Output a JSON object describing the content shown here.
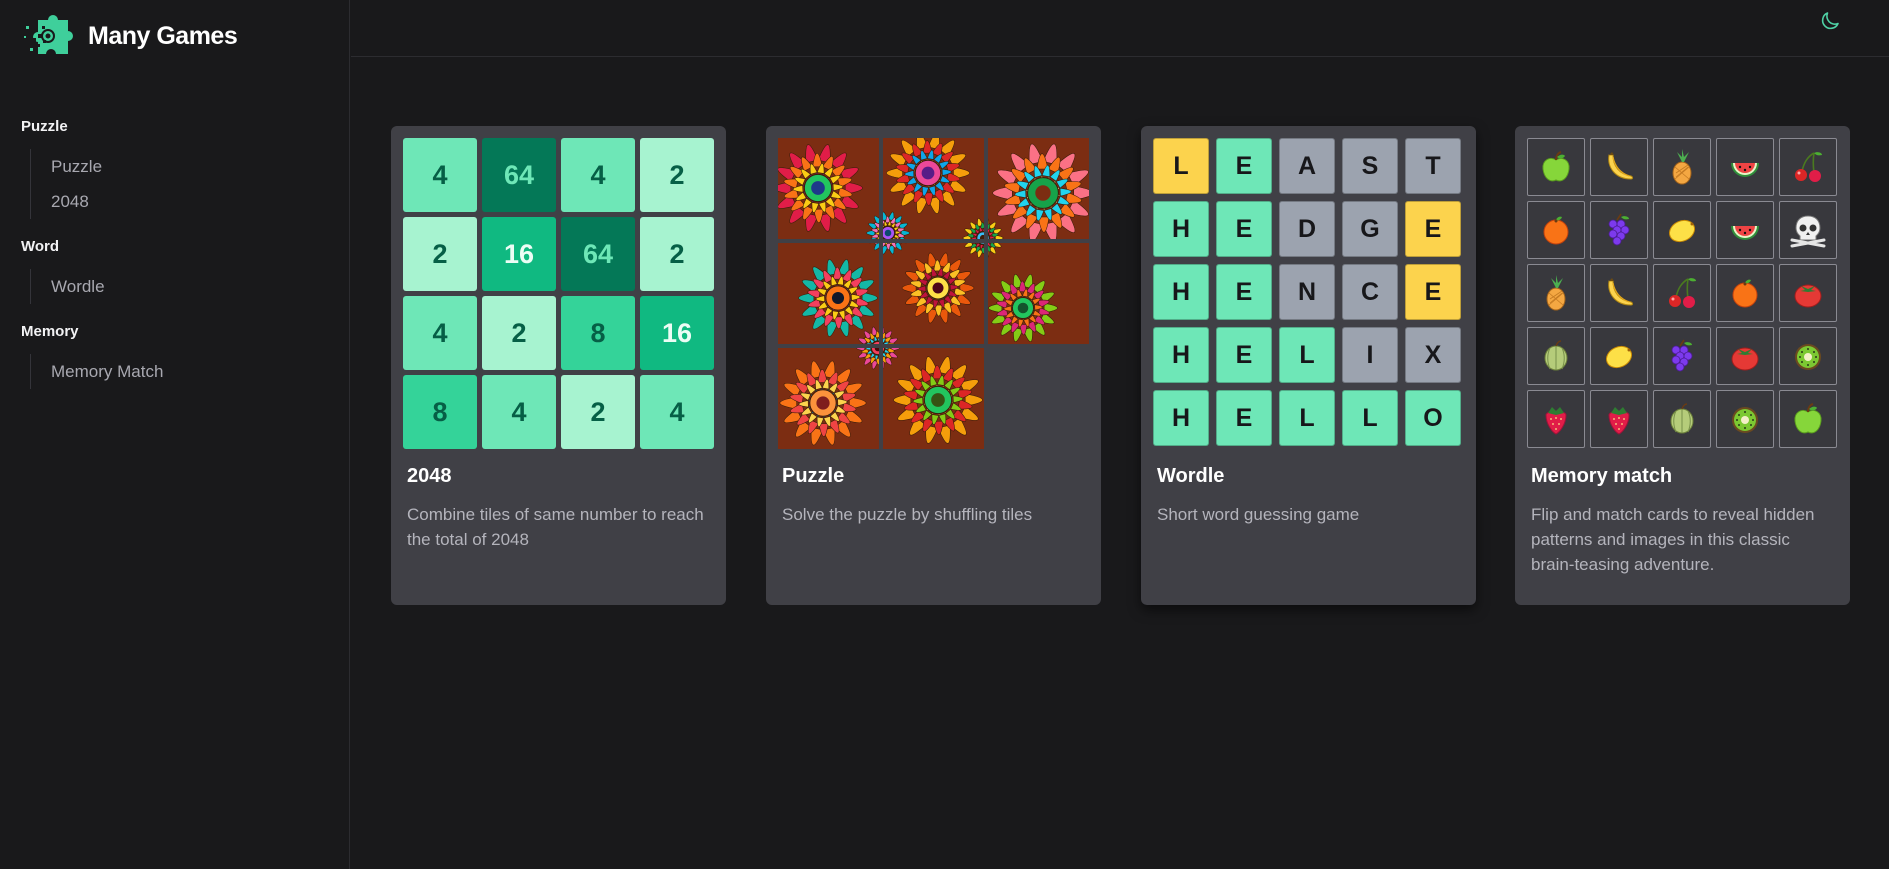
{
  "app": {
    "name": "Many Games"
  },
  "sidebar": {
    "groups": [
      {
        "title": "Puzzle",
        "items": [
          "Puzzle",
          "2048"
        ]
      },
      {
        "title": "Word",
        "items": [
          "Wordle"
        ]
      },
      {
        "title": "Memory",
        "items": [
          "Memory Match"
        ]
      }
    ]
  },
  "header": {
    "theme_toggle_icon": "moon-icon"
  },
  "colors": {
    "accent": "#4fd1a5",
    "card_bg": "#404046",
    "page_bg": "#19191b",
    "wordle_correct": "#6ee7b7",
    "wordle_present": "#fcd34d",
    "wordle_absent": "#9ca3af"
  },
  "cards": [
    {
      "title": "2048",
      "description": "Combine tiles of same number to reach the total of 2048",
      "tiles": [
        4,
        64,
        4,
        2,
        2,
        16,
        64,
        2,
        4,
        2,
        8,
        16,
        8,
        4,
        2,
        4
      ]
    },
    {
      "title": "Puzzle",
      "description": "Solve the puzzle by shuffling tiles",
      "tile_count": 8
    },
    {
      "title": "Wordle",
      "description": "Short word guessing game",
      "rows": [
        {
          "letters": [
            "L",
            "E",
            "A",
            "S",
            "T"
          ],
          "states": [
            "present",
            "correct",
            "absent",
            "absent",
            "absent"
          ]
        },
        {
          "letters": [
            "H",
            "E",
            "D",
            "G",
            "E"
          ],
          "states": [
            "correct",
            "correct",
            "absent",
            "absent",
            "present"
          ]
        },
        {
          "letters": [
            "H",
            "E",
            "N",
            "C",
            "E"
          ],
          "states": [
            "correct",
            "correct",
            "absent",
            "absent",
            "present"
          ]
        },
        {
          "letters": [
            "H",
            "E",
            "L",
            "I",
            "X"
          ],
          "states": [
            "correct",
            "correct",
            "correct",
            "absent",
            "absent"
          ]
        },
        {
          "letters": [
            "H",
            "E",
            "L",
            "L",
            "O"
          ],
          "states": [
            "correct",
            "correct",
            "correct",
            "correct",
            "correct"
          ]
        }
      ]
    },
    {
      "title": "Memory match",
      "description": "Flip and match cards to reveal hidden patterns and images in this classic brain-teasing adventure.",
      "cards": [
        "apple",
        "banana",
        "pineapple",
        "watermelon",
        "cherry",
        "orange",
        "grapes",
        "lemon",
        "watermelon",
        "skull",
        "pineapple",
        "banana",
        "cherry",
        "orange",
        "tomato",
        "melon",
        "lemon",
        "grapes",
        "tomato",
        "kiwi",
        "strawberry",
        "strawberry",
        "melon",
        "kiwi",
        "apple"
      ]
    }
  ]
}
